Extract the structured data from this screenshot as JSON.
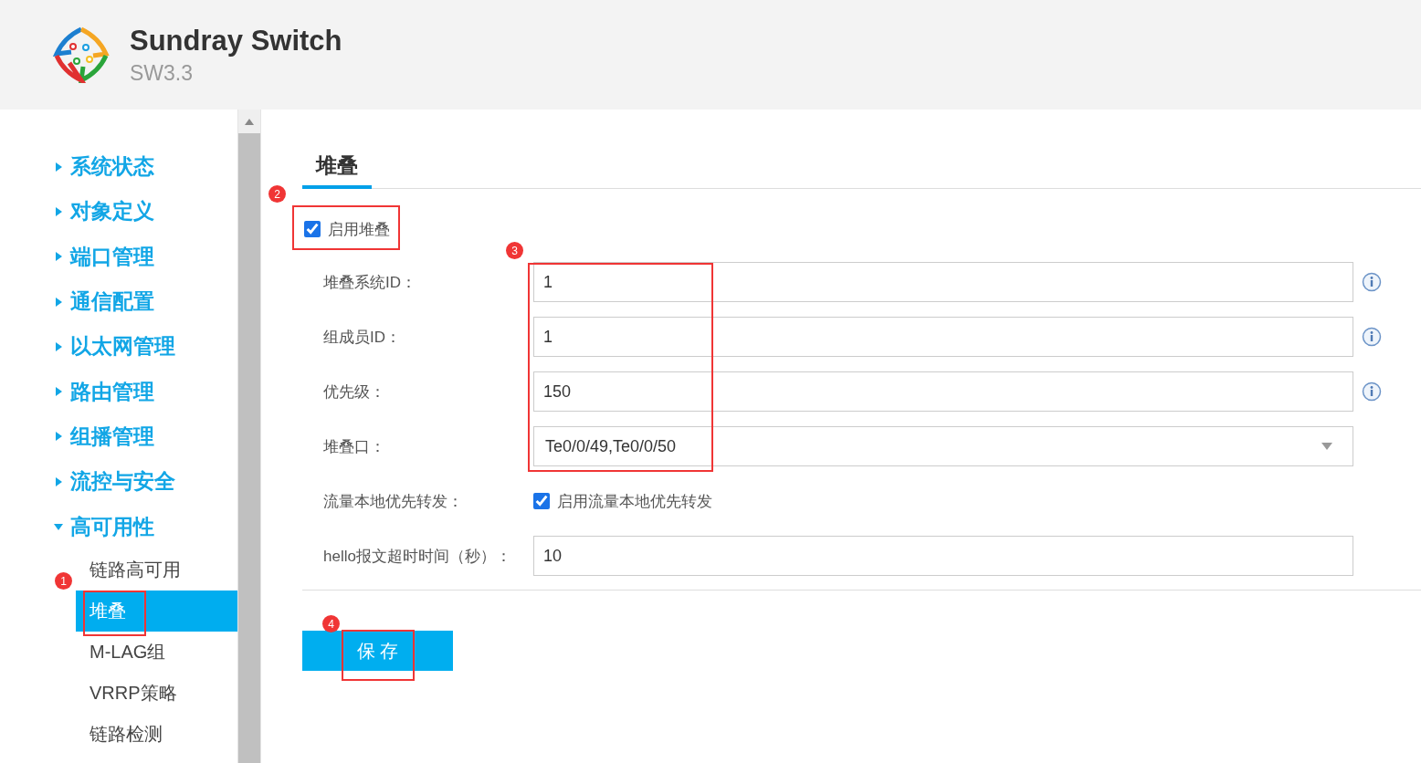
{
  "header": {
    "title": "Sundray Switch",
    "version": "SW3.3"
  },
  "sidebar": {
    "items": [
      {
        "label": "系统状态",
        "expanded": false
      },
      {
        "label": "对象定义",
        "expanded": false
      },
      {
        "label": "端口管理",
        "expanded": false
      },
      {
        "label": "通信配置",
        "expanded": false
      },
      {
        "label": "以太网管理",
        "expanded": false
      },
      {
        "label": "路由管理",
        "expanded": false
      },
      {
        "label": "组播管理",
        "expanded": false
      },
      {
        "label": "流控与安全",
        "expanded": false
      },
      {
        "label": "高可用性",
        "expanded": true,
        "children": [
          {
            "label": "链路高可用",
            "selected": false
          },
          {
            "label": "堆叠",
            "selected": true
          },
          {
            "label": "M-LAG组",
            "selected": false
          },
          {
            "label": "VRRP策略",
            "selected": false
          },
          {
            "label": "链路检测",
            "selected": false
          }
        ]
      }
    ]
  },
  "tabs": [
    {
      "label": "堆叠",
      "selected": true
    }
  ],
  "enable_checkbox": {
    "label": "启用堆叠",
    "checked": true
  },
  "form": [
    {
      "kind": "text",
      "label": "堆叠系统ID：",
      "value": "1",
      "info": true
    },
    {
      "kind": "text",
      "label": "组成员ID：",
      "value": "1",
      "info": true
    },
    {
      "kind": "text",
      "label": "优先级：",
      "value": "150",
      "info": true
    },
    {
      "kind": "select",
      "label": "堆叠口：",
      "value": "Te0/0/49,Te0/0/50"
    },
    {
      "kind": "checkbox",
      "label": "流量本地优先转发：",
      "option": "启用流量本地优先转发",
      "checked": true
    },
    {
      "kind": "text",
      "label": "hello报文超时时间（秒）：",
      "value": "10"
    }
  ],
  "save_button": "保 存",
  "annotations": [
    "1",
    "2",
    "3",
    "4"
  ]
}
